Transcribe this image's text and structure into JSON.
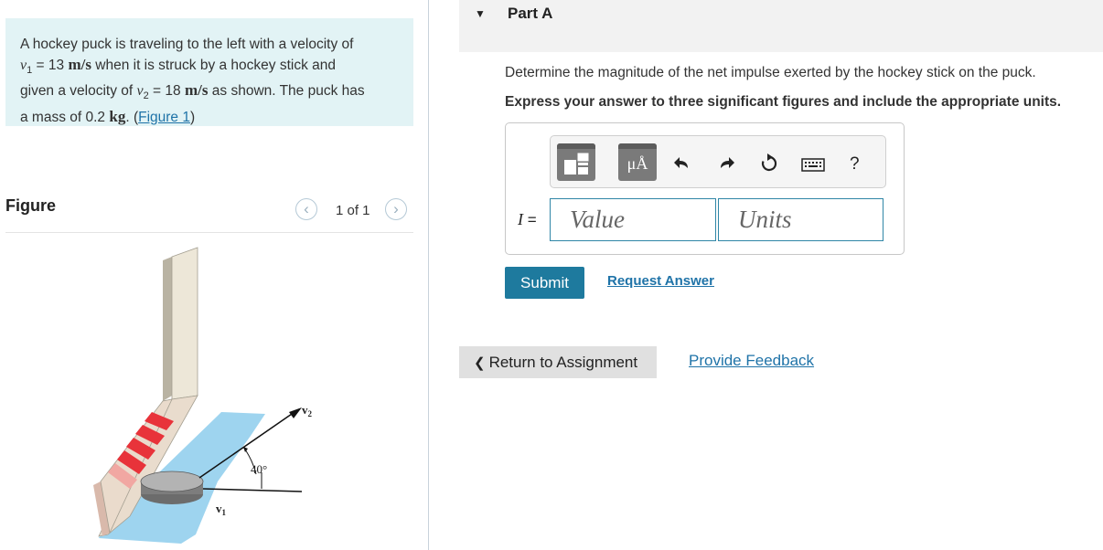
{
  "problem": {
    "line1": "A hockey puck is traveling to the left with a velocity of",
    "v1_symbol": "v",
    "v1_sub": "1",
    "v1_eq": " = 13 ",
    "v1_unit": "m/s",
    "line2_rest": " when it is struck by a hockey stick and",
    "line3_pre": "given a velocity of ",
    "v2_symbol": "v",
    "v2_sub": "2",
    "v2_eq": " = 18 ",
    "v2_unit": "m/s",
    "line3_rest": " as shown. The puck has",
    "line4_pre": "a mass of 0.2 ",
    "mass_unit": "kg",
    "line4_mid": ". (",
    "figure_link": "Figure 1",
    "line4_end": ")"
  },
  "figure": {
    "title": "Figure",
    "pager": "1 of 1",
    "prev_glyph": "‹",
    "next_glyph": "›",
    "label_v2": "v",
    "label_v2_sub": "2",
    "label_v1": "v",
    "label_v1_sub": "1",
    "angle": "40°"
  },
  "part": {
    "title": "Part A",
    "caret": "▼",
    "question": "Determine the magnitude of the net impulse exerted by the hockey stick on the puck.",
    "instruction": "Express your answer to three significant figures and include the appropriate units."
  },
  "answer": {
    "symbol": "I",
    "eq": " =",
    "value_placeholder": "Value",
    "units_placeholder": "Units"
  },
  "toolbar": {
    "units_glyph": "μÅ",
    "help": "?"
  },
  "actions": {
    "submit": "Submit",
    "request": "Request Answer",
    "return": "Return to Assignment",
    "return_glyph": "❮",
    "feedback": "Provide Feedback"
  },
  "colors": {
    "problem_bg": "#e2f3f5",
    "accent": "#1e7a9e",
    "link": "#1f73a8"
  }
}
